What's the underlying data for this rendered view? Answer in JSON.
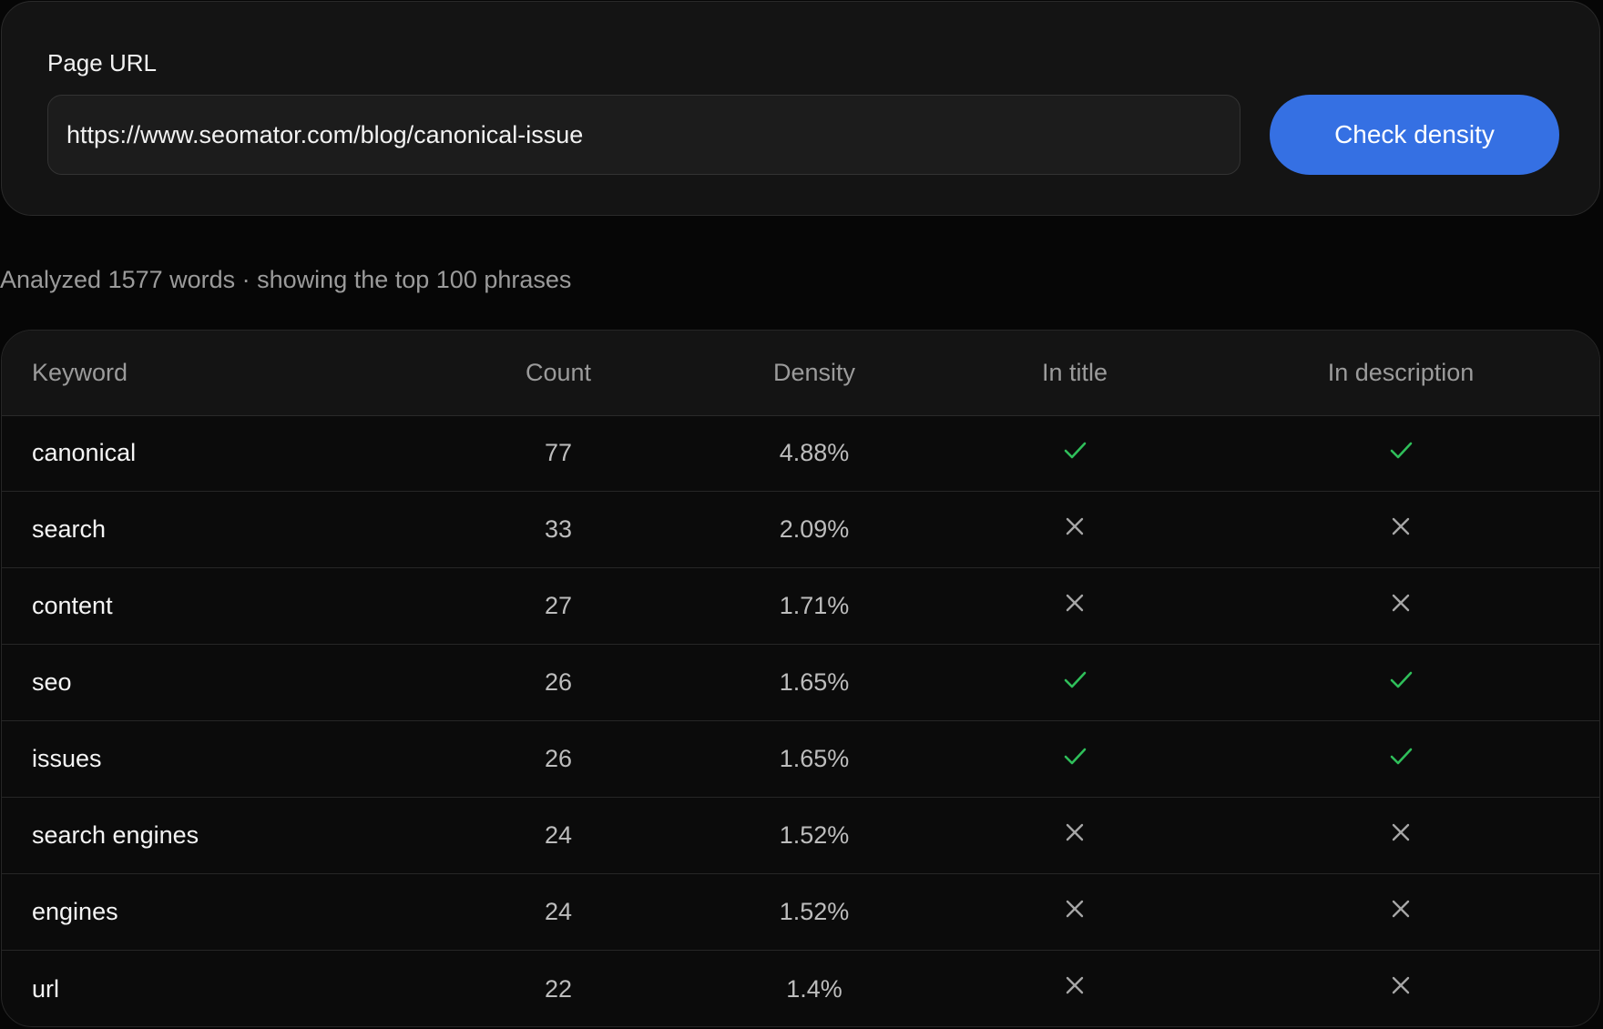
{
  "form": {
    "label": "Page URL",
    "url_value": "https://www.seomator.com/blog/canonical-issue",
    "button_label": "Check density"
  },
  "summary": "Analyzed 1577 words · showing the top 100 phrases",
  "table": {
    "headers": {
      "keyword": "Keyword",
      "count": "Count",
      "density": "Density",
      "in_title": "In title",
      "in_description": "In description"
    },
    "rows": [
      {
        "keyword": "canonical",
        "count": "77",
        "density": "4.88%",
        "in_title": true,
        "in_description": true
      },
      {
        "keyword": "search",
        "count": "33",
        "density": "2.09%",
        "in_title": false,
        "in_description": false
      },
      {
        "keyword": "content",
        "count": "27",
        "density": "1.71%",
        "in_title": false,
        "in_description": false
      },
      {
        "keyword": "seo",
        "count": "26",
        "density": "1.65%",
        "in_title": true,
        "in_description": true
      },
      {
        "keyword": "issues",
        "count": "26",
        "density": "1.65%",
        "in_title": true,
        "in_description": true
      },
      {
        "keyword": "search engines",
        "count": "24",
        "density": "1.52%",
        "in_title": false,
        "in_description": false
      },
      {
        "keyword": "engines",
        "count": "24",
        "density": "1.52%",
        "in_title": false,
        "in_description": false
      },
      {
        "keyword": "url",
        "count": "22",
        "density": "1.4%",
        "in_title": false,
        "in_description": false
      }
    ]
  },
  "colors": {
    "accent": "#3570e3",
    "check": "#2fbf5a",
    "cross": "#a6a6a6"
  },
  "icons": {
    "yes": "check-icon",
    "no": "cross-icon"
  }
}
